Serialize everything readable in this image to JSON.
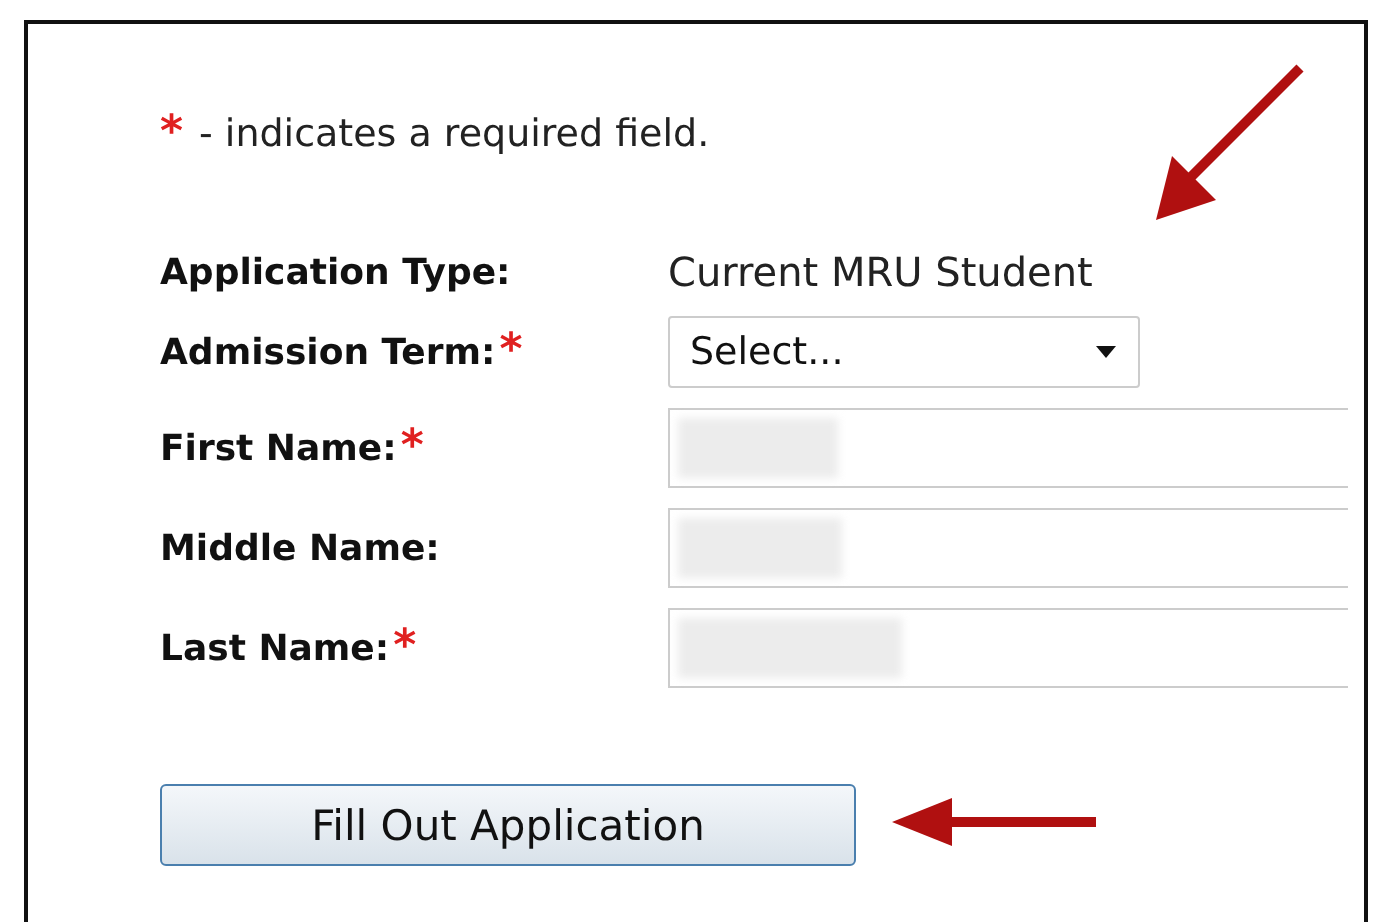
{
  "note": {
    "mark": "*",
    "text": "- indicates a required field."
  },
  "application_type": {
    "label": "Application Type:",
    "value": "Current MRU Student"
  },
  "fields": [
    {
      "kind": "select",
      "label": "Admission Term:",
      "required": true,
      "value": "Select..."
    },
    {
      "kind": "text",
      "label": "First Name:",
      "required": true
    },
    {
      "kind": "text",
      "label": "Middle Name:",
      "required": false
    },
    {
      "kind": "text",
      "label": "Last Name:",
      "required": true
    }
  ],
  "submit_button": "Fill Out Application"
}
